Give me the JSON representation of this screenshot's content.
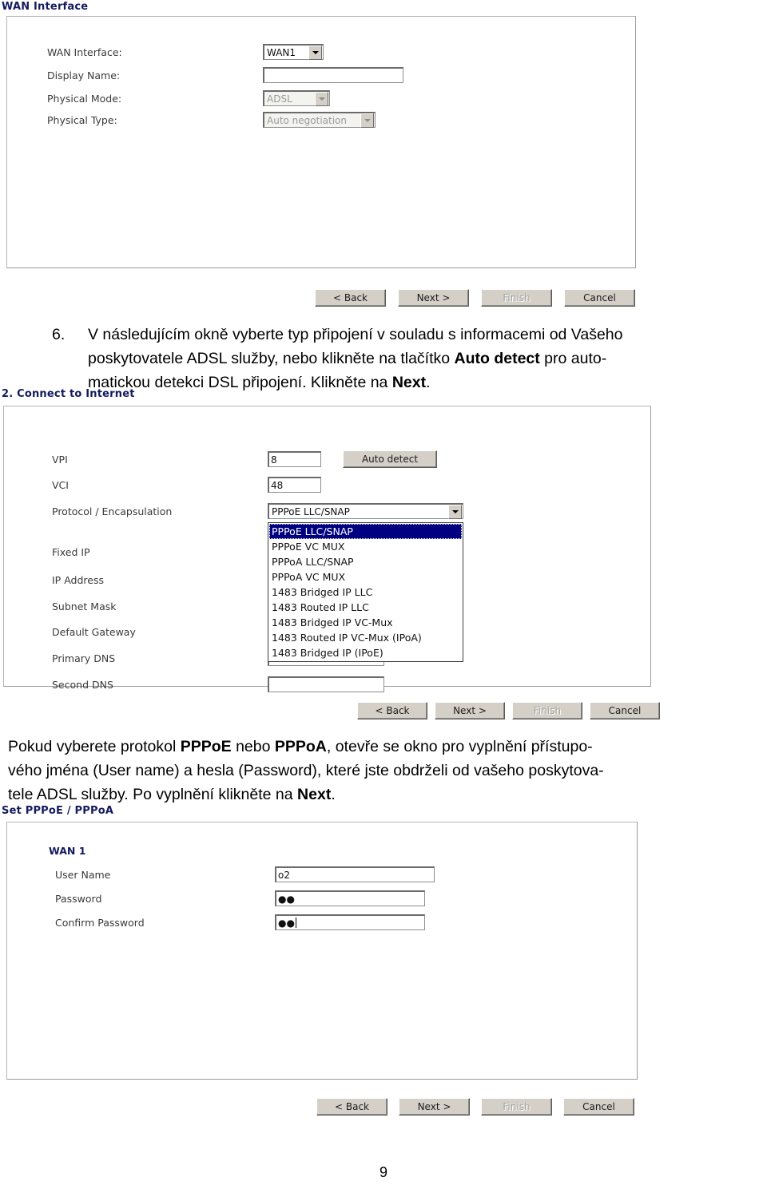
{
  "page": {
    "number": "9"
  },
  "screenshot1": {
    "title": "WAN Interface",
    "fields": [
      {
        "label": "WAN Interface:",
        "type": "select",
        "value": "WAN1",
        "disabled": false
      },
      {
        "label": "Display Name:",
        "type": "text",
        "value": "",
        "disabled": false
      },
      {
        "label": "Physical Mode:",
        "type": "select",
        "value": "ADSL",
        "disabled": true
      },
      {
        "label": "Physical Type:",
        "type": "select",
        "value": "Auto negotiation",
        "disabled": true
      }
    ],
    "buttons": [
      {
        "label": "< Back",
        "disabled": false
      },
      {
        "label": "Next >",
        "disabled": false
      },
      {
        "label": "Finish",
        "disabled": true
      },
      {
        "label": "Cancel",
        "disabled": false
      }
    ]
  },
  "step6": {
    "number": "6.",
    "line1_a": "V následujícím okně vyberte typ připojení v souladu s informacemi od Vašeho",
    "line2_a": "poskytovatele ADSL služby, nebo klikněte na tlačítko ",
    "line2_b": "Auto detect",
    "line2_c": " pro auto-",
    "line3_a": "matickou detekci DSL připojení. Klikněte na ",
    "line3_b": "Next",
    "line3_c": "."
  },
  "screenshot2": {
    "title": "2. Connect to Internet",
    "vpi": {
      "label": "VPI",
      "value": "8"
    },
    "vci": {
      "label": "VCI",
      "value": "48"
    },
    "auto_detect_button": "Auto detect",
    "protocol": {
      "label": "Protocol / Encapsulation",
      "value": "PPPoE LLC/SNAP",
      "options": [
        "PPPoE LLC/SNAP",
        "PPPoE VC MUX",
        "PPPoA LLC/SNAP",
        "PPPoA VC MUX",
        "1483 Bridged IP LLC",
        "1483 Routed IP LLC",
        "1483 Bridged IP VC-Mux",
        "1483 Routed IP VC-Mux (IPoA)",
        "1483 Bridged IP (IPoE)"
      ],
      "selected_index": 0
    },
    "ip_labels": [
      "Fixed IP",
      "IP Address",
      "Subnet Mask",
      "Default Gateway",
      "Primary DNS",
      "Second DNS"
    ],
    "buttons": [
      {
        "label": "< Back",
        "disabled": false
      },
      {
        "label": "Next >",
        "disabled": false
      },
      {
        "label": "Finish",
        "disabled": true
      },
      {
        "label": "Cancel",
        "disabled": false
      }
    ]
  },
  "pppoe_para": {
    "line1_a": "Pokud vyberete protokol ",
    "line1_b": "PPPoE",
    "line1_c": " nebo ",
    "line1_d": "PPPoA",
    "line1_e": ", otevře se okno pro vyplnění přístupo-",
    "line2": "vého jména (User name) a hesla (Password), které jste obdrželi od vašeho poskytova-",
    "line3_a": "tele ADSL služby. Po vyplnění klikněte na ",
    "line3_b": "Next",
    "line3_c": "."
  },
  "screenshot3": {
    "title": "Set PPPoE / PPPoA",
    "group_heading": "WAN 1",
    "fields": [
      {
        "label": "User Name",
        "value": "o2",
        "caret": false
      },
      {
        "label": "Password",
        "value": "●●",
        "caret": false
      },
      {
        "label": "Confirm Password",
        "value": "●●",
        "caret": true
      }
    ],
    "buttons": [
      {
        "label": "< Back",
        "disabled": false
      },
      {
        "label": "Next >",
        "disabled": false
      },
      {
        "label": "Finish",
        "disabled": true
      },
      {
        "label": "Cancel",
        "disabled": false
      }
    ]
  },
  "colors": {
    "header_navy": "#141b5e",
    "select_highlight": "#000080",
    "button_face": "#d4d0c8"
  }
}
